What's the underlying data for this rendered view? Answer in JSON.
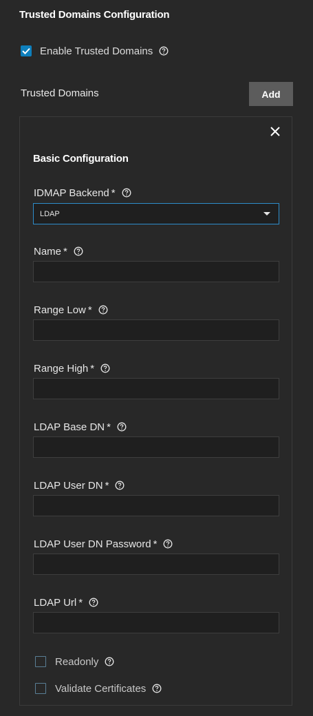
{
  "section": {
    "title": "Trusted Domains Configuration",
    "enable_label": "Enable Trusted Domains",
    "enable_checked": true,
    "list_label": "Trusted Domains",
    "add_label": "Add"
  },
  "panel": {
    "title": "Basic Configuration",
    "idmap": {
      "label": "IDMAP Backend",
      "required": "*",
      "value": "LDAP"
    },
    "fields": [
      {
        "label": "Name",
        "required": "*",
        "value": ""
      },
      {
        "label": "Range Low",
        "required": "*",
        "value": ""
      },
      {
        "label": "Range High",
        "required": "*",
        "value": ""
      },
      {
        "label": "LDAP Base DN",
        "required": "*",
        "value": ""
      },
      {
        "label": "LDAP User DN",
        "required": "*",
        "value": ""
      },
      {
        "label": "LDAP User DN Password",
        "required": "*",
        "value": ""
      },
      {
        "label": "LDAP Url",
        "required": "*",
        "value": ""
      }
    ],
    "checkboxes": [
      {
        "label": "Readonly",
        "checked": false
      },
      {
        "label": "Validate Certificates",
        "checked": false
      }
    ]
  },
  "colors": {
    "background": "#282828",
    "accent": "#0e7fbc",
    "input_background": "#1f1f1f",
    "button_background": "#5c5c5c"
  }
}
